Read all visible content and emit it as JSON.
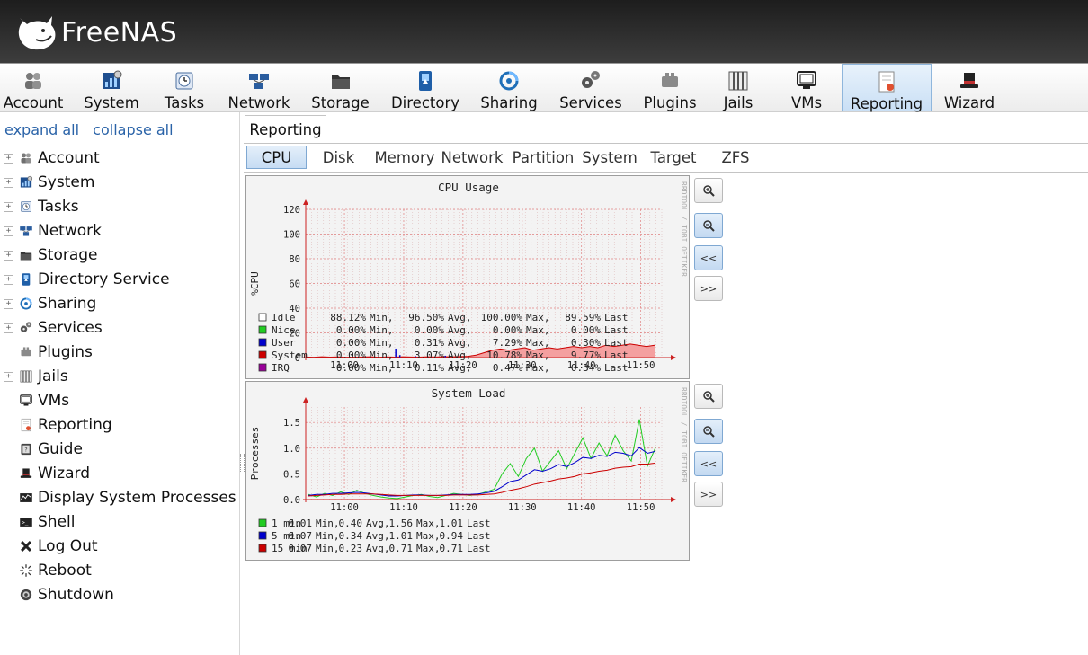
{
  "app": {
    "title": "FreeNAS"
  },
  "toolbar": {
    "items": [
      {
        "label": "Account",
        "icon": "account-icon"
      },
      {
        "label": "System",
        "icon": "system-icon"
      },
      {
        "label": "Tasks",
        "icon": "tasks-icon"
      },
      {
        "label": "Network",
        "icon": "network-icon"
      },
      {
        "label": "Storage",
        "icon": "storage-icon"
      },
      {
        "label": "Directory",
        "icon": "directory-icon"
      },
      {
        "label": "Sharing",
        "icon": "sharing-icon"
      },
      {
        "label": "Services",
        "icon": "services-icon"
      },
      {
        "label": "Plugins",
        "icon": "plugins-icon"
      },
      {
        "label": "Jails",
        "icon": "jails-icon"
      },
      {
        "label": "VMs",
        "icon": "vms-icon"
      },
      {
        "label": "Reporting",
        "icon": "reporting-icon"
      },
      {
        "label": "Wizard",
        "icon": "wizard-icon"
      }
    ],
    "active": "Reporting"
  },
  "sidebar": {
    "expand_all": "expand all",
    "collapse_all": "collapse all",
    "items": [
      {
        "label": "Account",
        "expandable": true,
        "icon": "account-icon"
      },
      {
        "label": "System",
        "expandable": true,
        "icon": "system-icon"
      },
      {
        "label": "Tasks",
        "expandable": true,
        "icon": "tasks-icon"
      },
      {
        "label": "Network",
        "expandable": true,
        "icon": "network-icon"
      },
      {
        "label": "Storage",
        "expandable": true,
        "icon": "storage-icon"
      },
      {
        "label": "Directory Service",
        "expandable": true,
        "icon": "directory-icon"
      },
      {
        "label": "Sharing",
        "expandable": true,
        "icon": "sharing-icon"
      },
      {
        "label": "Services",
        "expandable": true,
        "icon": "services-icon"
      },
      {
        "label": "Plugins",
        "expandable": false,
        "icon": "plugins-icon"
      },
      {
        "label": "Jails",
        "expandable": true,
        "icon": "jails-icon"
      },
      {
        "label": "VMs",
        "expandable": false,
        "icon": "vms-icon"
      },
      {
        "label": "Reporting",
        "expandable": false,
        "icon": "reporting-icon"
      },
      {
        "label": "Guide",
        "expandable": false,
        "icon": "guide-icon"
      },
      {
        "label": "Wizard",
        "expandable": false,
        "icon": "wizard-icon"
      },
      {
        "label": "Display System Processes",
        "expandable": false,
        "icon": "processes-icon"
      },
      {
        "label": "Shell",
        "expandable": false,
        "icon": "shell-icon"
      },
      {
        "label": "Log Out",
        "expandable": false,
        "icon": "logout-icon"
      },
      {
        "label": "Reboot",
        "expandable": false,
        "icon": "reboot-icon"
      },
      {
        "label": "Shutdown",
        "expandable": false,
        "icon": "shutdown-icon"
      }
    ]
  },
  "main": {
    "tab": "Reporting",
    "subtabs": [
      "CPU",
      "Disk",
      "Memory",
      "Network",
      "Partition",
      "System",
      "Target",
      "ZFS"
    ],
    "active_subtab": "CPU",
    "controls": {
      "zoom_in": "zoom-in-icon",
      "zoom_out": "zoom-out-icon",
      "back": "<<",
      "forward": ">>"
    },
    "watermark": "RRDTOOL / TOBI OETIKER"
  },
  "colors": {
    "green": "#22cc22",
    "blue": "#0000cc",
    "red": "#cc0000",
    "purple": "#990099",
    "grid_major": "#e08080",
    "grid_minor": "#d9b0b0",
    "axis": "#cc2222",
    "tab_active": "#c6dcf3",
    "link": "#2a63a8"
  },
  "chart_data": [
    {
      "type": "area",
      "title": "CPU Usage",
      "ylabel": "%CPU",
      "xlabel": "",
      "x_ticks": [
        "11:00",
        "11:10",
        "11:20",
        "11:30",
        "11:40",
        "11:50"
      ],
      "y_ticks": [
        0,
        20,
        40,
        60,
        80,
        100,
        120
      ],
      "ylim": [
        0,
        120
      ],
      "grid": true,
      "series": [
        {
          "name": "Idle",
          "color": "#ffffff",
          "min": "88.12%",
          "avg": "96.50%",
          "max": "100.00%",
          "last": "89.59%"
        },
        {
          "name": "Nice",
          "color": "#22cc22",
          "min": "0.00%",
          "avg": "0.00%",
          "max": "0.00%",
          "last": "0.00%"
        },
        {
          "name": "User",
          "color": "#0000cc",
          "min": "0.00%",
          "avg": "0.31%",
          "max": "7.29%",
          "last": "0.30%"
        },
        {
          "name": "System",
          "color": "#cc0000",
          "min": "0.00%",
          "avg": "3.07%",
          "max": "10.78%",
          "last": "9.77%"
        },
        {
          "name": "IRQ",
          "color": "#990099",
          "min": "0.00%",
          "avg": "0.11%",
          "max": "0.47%",
          "last": "0.34%"
        }
      ],
      "system_values": [
        0.5,
        0.3,
        0.6,
        0.4,
        0.5,
        0.3,
        0.4,
        0.5,
        0.6,
        0.3,
        0.5,
        0.4,
        0.6,
        0.5,
        0.4,
        0.6,
        0.5,
        0.7,
        0.6,
        0.8,
        1,
        2,
        4,
        6,
        7,
        6,
        7,
        8,
        6,
        7,
        8,
        7,
        8,
        9,
        8,
        9,
        8,
        10,
        9,
        10,
        11,
        10,
        9,
        10
      ],
      "user_spikes": [
        [
          11.1,
          7.3
        ],
        [
          11.6,
          2
        ],
        [
          13.5,
          1.5
        ],
        [
          17.2,
          1.5
        ]
      ]
    },
    {
      "type": "line",
      "title": "System Load",
      "ylabel": "Processes",
      "xlabel": "",
      "x_ticks": [
        "11:00",
        "11:10",
        "11:20",
        "11:30",
        "11:40",
        "11:50"
      ],
      "y_ticks": [
        "0.0",
        "0.5",
        "1.0",
        "1.5"
      ],
      "ylim": [
        0,
        1.8
      ],
      "grid": true,
      "series": [
        {
          "name": "1 min",
          "color": "#22cc22",
          "min": "0.01",
          "avg": "0.40",
          "max": "1.56",
          "last": "1.01",
          "values": [
            0.1,
            0.05,
            0.12,
            0.08,
            0.15,
            0.1,
            0.18,
            0.12,
            0.08,
            0.05,
            0.03,
            0.02,
            0.05,
            0.08,
            0.1,
            0.06,
            0.04,
            0.08,
            0.12,
            0.1,
            0.08,
            0.1,
            0.15,
            0.2,
            0.5,
            0.7,
            0.45,
            0.8,
            1.0,
            0.55,
            0.75,
            0.95,
            0.6,
            0.9,
            1.2,
            0.8,
            1.1,
            0.85,
            1.25,
            0.95,
            0.75,
            1.56,
            0.65,
            1.01
          ]
        },
        {
          "name": "5 min",
          "color": "#0000cc",
          "min": "0.07",
          "avg": "0.34",
          "max": "1.01",
          "last": "0.94",
          "values": [
            0.08,
            0.1,
            0.1,
            0.12,
            0.12,
            0.13,
            0.14,
            0.13,
            0.11,
            0.09,
            0.07,
            0.07,
            0.08,
            0.09,
            0.09,
            0.08,
            0.08,
            0.09,
            0.1,
            0.1,
            0.1,
            0.11,
            0.13,
            0.16,
            0.25,
            0.35,
            0.38,
            0.48,
            0.58,
            0.55,
            0.6,
            0.68,
            0.64,
            0.72,
            0.82,
            0.8,
            0.86,
            0.84,
            0.92,
            0.9,
            0.85,
            1.01,
            0.9,
            0.94
          ]
        },
        {
          "name": "15 min",
          "color": "#cc0000",
          "min": "0.07",
          "avg": "0.23",
          "max": "0.71",
          "last": "0.71",
          "values": [
            0.07,
            0.08,
            0.09,
            0.1,
            0.1,
            0.11,
            0.11,
            0.11,
            0.11,
            0.1,
            0.09,
            0.08,
            0.08,
            0.08,
            0.08,
            0.08,
            0.08,
            0.08,
            0.09,
            0.09,
            0.09,
            0.09,
            0.1,
            0.11,
            0.14,
            0.18,
            0.21,
            0.25,
            0.3,
            0.33,
            0.36,
            0.4,
            0.42,
            0.45,
            0.5,
            0.52,
            0.55,
            0.57,
            0.61,
            0.63,
            0.64,
            0.69,
            0.69,
            0.71
          ]
        }
      ]
    }
  ]
}
